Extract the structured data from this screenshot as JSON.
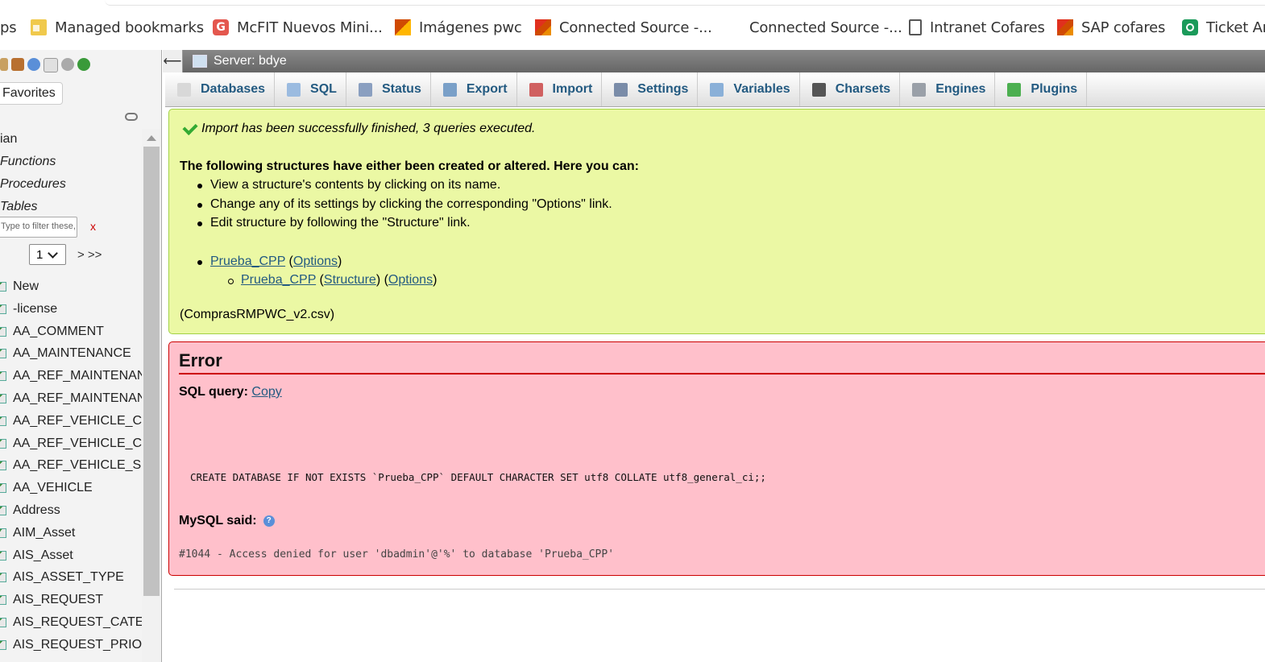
{
  "bookmarks": [
    {
      "label": "ps",
      "icon": "apps-icon"
    },
    {
      "label": "Managed bookmarks",
      "icon": "folder-icon"
    },
    {
      "label": "McFIT Nuevos Mini...",
      "icon": "g-icon"
    },
    {
      "label": "Imágenes pwc",
      "icon": "pwc-icon"
    },
    {
      "label": "Connected Source -...",
      "icon": "pwc-icon"
    },
    {
      "label": "Connected Source -...",
      "icon": ""
    },
    {
      "label": "Intranet Cofares",
      "icon": "document-icon"
    },
    {
      "label": "SAP cofares",
      "icon": "pwc-icon"
    },
    {
      "label": "Ticket An",
      "icon": "ticket-icon"
    }
  ],
  "nav": {
    "favorites": "Favorites",
    "tree": [
      "ian",
      "Functions",
      "Procedures",
      "Tables"
    ],
    "filter_placeholder": "Type to filter these,",
    "clear": "x",
    "page": "1",
    "page_next": "> >>",
    "tables": [
      "New",
      "-license",
      "AA_COMMENT",
      "AA_MAINTENANCE",
      "AA_REF_MAINTENAN",
      "AA_REF_MAINTENAN",
      "AA_REF_VEHICLE_C",
      "AA_REF_VEHICLE_C",
      "AA_REF_VEHICLE_S",
      "AA_VEHICLE",
      "Address",
      "AIM_Asset",
      "AIS_Asset",
      "AIS_ASSET_TYPE",
      "AIS_REQUEST",
      "AIS_REQUEST_CATE",
      "AIS_REQUEST_PRIO"
    ]
  },
  "server_bar": {
    "title": "Server: bdye"
  },
  "tabs": [
    {
      "label": "Databases",
      "icon": "database-icon",
      "color": "#d8d8d8"
    },
    {
      "label": "SQL",
      "icon": "sql-icon",
      "color": "#9bbbe0"
    },
    {
      "label": "Status",
      "icon": "status-icon",
      "color": "#8a9fc0"
    },
    {
      "label": "Export",
      "icon": "export-icon",
      "color": "#7aa0c8"
    },
    {
      "label": "Import",
      "icon": "import-icon",
      "color": "#d06060"
    },
    {
      "label": "Settings",
      "icon": "wrench-icon",
      "color": "#7a8ca8"
    },
    {
      "label": "Variables",
      "icon": "variables-icon",
      "color": "#8ab0d8"
    },
    {
      "label": "Charsets",
      "icon": "charsets-icon",
      "color": "#555555"
    },
    {
      "label": "Engines",
      "icon": "engines-icon",
      "color": "#9aa0a8"
    },
    {
      "label": "Plugins",
      "icon": "puzzle-icon",
      "color": "#4caf50"
    }
  ],
  "success": {
    "message": "Import has been successfully finished, 3 queries executed.",
    "heading": "The following structures have either been created or altered. Here you can:",
    "bullets": [
      "View a structure's contents by clicking on its name.",
      "Change any of its settings by clicking the corresponding \"Options\" link.",
      "Edit structure by following the \"Structure\" link."
    ],
    "db_name": "Prueba_CPP",
    "options": "Options",
    "structure": "Structure",
    "file": "(ComprasRMPWC_v2.csv)"
  },
  "error": {
    "title": "Error",
    "sql_label": "SQL query:",
    "copy": "Copy",
    "query": "CREATE DATABASE IF NOT EXISTS `Prueba_CPP` DEFAULT CHARACTER SET utf8 COLLATE utf8_general_ci;;",
    "mysql_said": "MySQL said:",
    "message": "#1044 - Access denied for user 'dbadmin'@'%' to database 'Prueba_CPP'"
  }
}
